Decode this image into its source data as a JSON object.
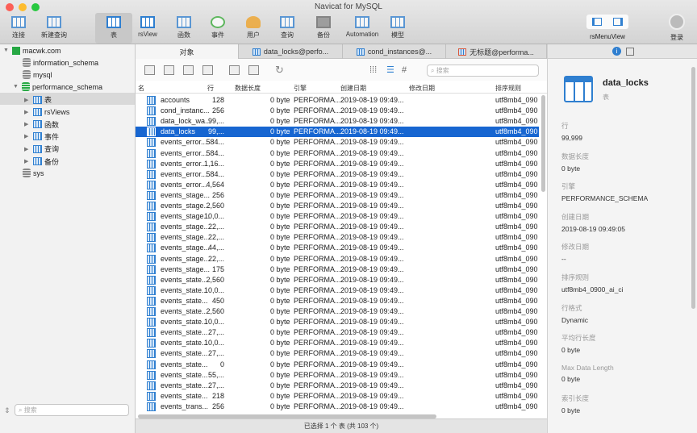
{
  "window": {
    "title": "Navicat for MySQL"
  },
  "toolbar": {
    "items": [
      {
        "label": "连接",
        "icon": "connect-icon"
      },
      {
        "label": "新建查询",
        "icon": "new-query-icon"
      },
      {
        "label": "表",
        "icon": "table-icon"
      },
      {
        "label": "rsView",
        "icon": "view-icon"
      },
      {
        "label": "函数",
        "icon": "function-icon"
      },
      {
        "label": "事件",
        "icon": "event-icon"
      },
      {
        "label": "用户",
        "icon": "user-icon"
      },
      {
        "label": "查询",
        "icon": "query-icon"
      },
      {
        "label": "备份",
        "icon": "backup-icon"
      },
      {
        "label": "Automation",
        "icon": "automation-icon"
      },
      {
        "label": "模型",
        "icon": "model-icon"
      }
    ],
    "menu_view": "rsMenuView",
    "login": "登录"
  },
  "sidebar": {
    "connection": "macwk.com",
    "databases": [
      "information_schema",
      "mysql",
      "performance_schema",
      "sys"
    ],
    "children": [
      "表",
      "rsViews",
      "函数",
      "事件",
      "查询",
      "备份"
    ],
    "search_placeholder": "搜索"
  },
  "tabs": [
    "对象",
    "data_locks@perfo...",
    "cond_instances@...",
    "无标题@performa..."
  ],
  "search_placeholder": "搜索",
  "columns": [
    "名",
    "行",
    "数据长度",
    "引擎",
    "创建日期",
    "修改日期",
    "排序规则"
  ],
  "rows": [
    [
      "accounts",
      "128"
    ],
    [
      "cond_instanc...",
      "256"
    ],
    [
      "data_lock_wa...",
      "99,..."
    ],
    [
      "data_locks",
      "99,..."
    ],
    [
      "events_error...",
      "584..."
    ],
    [
      "events_error...",
      "584..."
    ],
    [
      "events_error...",
      "1,16..."
    ],
    [
      "events_error...",
      "584..."
    ],
    [
      "events_error...",
      "4,564"
    ],
    [
      "events_stage...",
      "256"
    ],
    [
      "events_stage...",
      "2,560"
    ],
    [
      "events_stage...",
      "10,0..."
    ],
    [
      "events_stage...",
      "22,..."
    ],
    [
      "events_stage...",
      "22,..."
    ],
    [
      "events_stage...",
      "44,..."
    ],
    [
      "events_stage...",
      "22,..."
    ],
    [
      "events_stage...",
      "175"
    ],
    [
      "events_state...",
      "2,560"
    ],
    [
      "events_state...",
      "10,0..."
    ],
    [
      "events_state...",
      "450"
    ],
    [
      "events_state...",
      "2,560"
    ],
    [
      "events_state...",
      "10,0..."
    ],
    [
      "events_state...",
      "27,..."
    ],
    [
      "events_state...",
      "10,0..."
    ],
    [
      "events_state...",
      "27,..."
    ],
    [
      "events_state...",
      "0"
    ],
    [
      "events_state...",
      "55,..."
    ],
    [
      "events_state...",
      "27,..."
    ],
    [
      "events_state...",
      "218"
    ],
    [
      "events_trans...",
      "256"
    ]
  ],
  "row_common": {
    "size": "0 byte",
    "engine": "PERFORMA...",
    "created": "2019-08-19 09:49...",
    "collation": "utf8mb4_090"
  },
  "selected_index": 3,
  "status": "已选择 1 个 表 (共 103 个)",
  "panel": {
    "name": "data_locks",
    "type": "表",
    "fields": [
      {
        "k": "行",
        "v": "99,999"
      },
      {
        "k": "数据长度",
        "v": "0 byte"
      },
      {
        "k": "引擎",
        "v": "PERFORMANCE_SCHEMA"
      },
      {
        "k": "创建日期",
        "v": "2019-08-19 09:49:05"
      },
      {
        "k": "修改日期",
        "v": "--"
      },
      {
        "k": "排序规则",
        "v": "utf8mb4_0900_ai_ci"
      },
      {
        "k": "行格式",
        "v": "Dynamic"
      },
      {
        "k": "平均行长度",
        "v": "0 byte"
      },
      {
        "k": "Max Data Length",
        "v": "0 byte"
      },
      {
        "k": "索引长度",
        "v": "0 byte"
      }
    ]
  },
  "colors": {
    "accent": "#1766d1",
    "table_icon": "#2f7fd0"
  }
}
